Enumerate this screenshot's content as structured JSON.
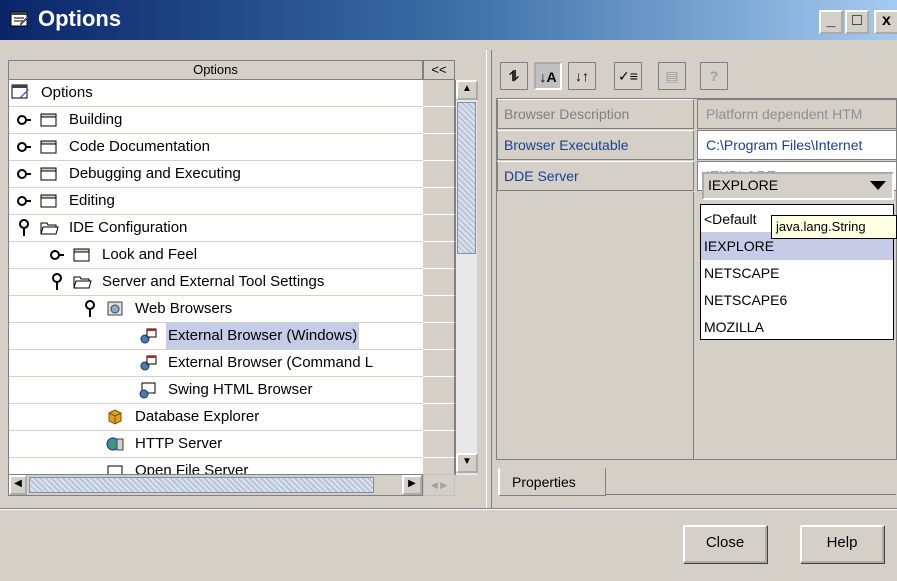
{
  "window": {
    "title": "Options",
    "icon": "options-window-icon",
    "controls": {
      "minimize": "_",
      "maximize": "□",
      "close": "x"
    }
  },
  "left_pane": {
    "header": "Options",
    "collapse_label": "<<",
    "tree": [
      {
        "label": "Options",
        "icon": "options-root-icon",
        "expander": ""
      },
      {
        "label": "Building",
        "icon": "folder-icon",
        "expander": "key-collapsed"
      },
      {
        "label": "Code Documentation",
        "icon": "folder-icon",
        "expander": "key-collapsed"
      },
      {
        "label": "Debugging and Executing",
        "icon": "folder-icon",
        "expander": "key-collapsed"
      },
      {
        "label": "Editing",
        "icon": "folder-icon",
        "expander": "key-collapsed"
      },
      {
        "label": "IDE Configuration",
        "icon": "folder-open-icon",
        "expander": "key-expanded"
      },
      {
        "label": "Look and Feel",
        "icon": "folder-icon",
        "expander": "key-collapsed"
      },
      {
        "label": "Server and External Tool Settings",
        "icon": "folder-open-icon",
        "expander": "key-expanded"
      },
      {
        "label": "Web Browsers",
        "icon": "web-browsers-icon",
        "expander": "key-expanded"
      },
      {
        "label": "External Browser (Windows)",
        "icon": "external-browser-icon",
        "expander": "",
        "selected": true
      },
      {
        "label": "External Browser (Command L",
        "icon": "external-browser-icon",
        "expander": ""
      },
      {
        "label": "Swing HTML Browser",
        "icon": "swing-browser-icon",
        "expander": ""
      },
      {
        "label": "Database Explorer",
        "icon": "database-icon",
        "expander": ""
      },
      {
        "label": "HTTP Server",
        "icon": "http-server-icon",
        "expander": ""
      },
      {
        "label": "Open File Server",
        "icon": "file-server-icon",
        "expander": ""
      }
    ]
  },
  "toolbar": {
    "buttons": [
      {
        "name": "unsorted-button",
        "icon": "unsorted-icon",
        "glyph": "⥮"
      },
      {
        "name": "sort-by-name-button",
        "icon": "sort-az-icon",
        "glyph": "↓A"
      },
      {
        "name": "sort-by-type-button",
        "icon": "sort-type-icon",
        "glyph": "↓↑"
      },
      {
        "name": "show-editable-button",
        "icon": "editable-only-icon",
        "glyph": "✓≡"
      },
      {
        "name": "customize-button",
        "icon": "customize-icon",
        "glyph": "▤"
      },
      {
        "name": "help-toolbar-button",
        "icon": "help-icon",
        "glyph": "?"
      }
    ]
  },
  "properties": [
    {
      "name": "Browser Description",
      "value": "Platform dependent HTM",
      "disabled": true
    },
    {
      "name": "Browser Executable",
      "value": "C:\\Program Files\\Internet",
      "disabled": false
    },
    {
      "name": "DDE Server",
      "value": "IEXPLORE",
      "disabled": false
    }
  ],
  "dde_dropdown": {
    "selected": "IEXPLORE",
    "options": [
      "<Default",
      "IEXPLORE",
      "NETSCAPE",
      "NETSCAPE6",
      "MOZILLA"
    ],
    "highlighted_index": 1
  },
  "tooltip": "java.lang.String",
  "tabs": [
    {
      "label": "Properties"
    }
  ],
  "buttons": {
    "close": "Close",
    "help": "Help"
  },
  "colors": {
    "titlebar_start": "#0a246a",
    "titlebar_end": "#a6caf0",
    "selection": "#c6cbe8",
    "property_text": "#1a3f96"
  }
}
